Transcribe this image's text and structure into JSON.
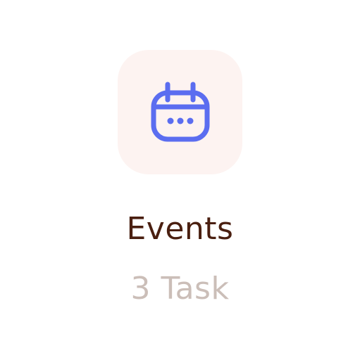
{
  "category_card": {
    "icon": "calendar-icon",
    "title": "Events",
    "subtitle": "3 Task",
    "colors": {
      "tile_background": "#fdf3f1",
      "icon": "#5b6df0",
      "title": "#4a1f10",
      "subtitle": "#cbbeb8"
    }
  }
}
